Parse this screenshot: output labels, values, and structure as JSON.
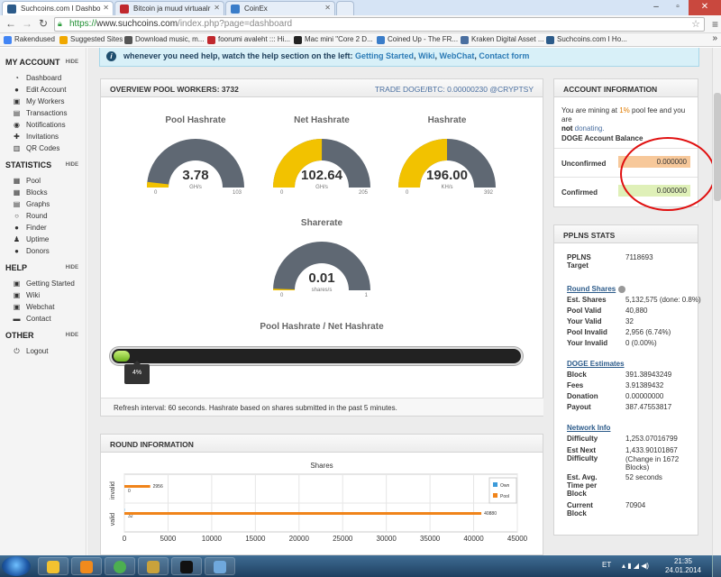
{
  "browser": {
    "tabs": [
      {
        "label": "Suchcoins.com I Dashbo",
        "active": true,
        "color": "#2c5b8a"
      },
      {
        "label": "Bitcoin ja muud virtuaalr",
        "active": false,
        "color": "#c0282d"
      },
      {
        "label": "CoinEx",
        "active": false,
        "color": "#3a7dc9"
      }
    ],
    "url_scheme": "https://",
    "url_host": "www.suchcoins.com",
    "url_path": "/index.php?page=dashboard",
    "bookmarks": [
      {
        "label": "Rakendused",
        "color": "#4285f4"
      },
      {
        "label": "Suggested Sites",
        "color": "#f0a800"
      },
      {
        "label": "Download music, m...",
        "color": "#555555"
      },
      {
        "label": "foorumi avaleht ::: Hi...",
        "color": "#c0282d"
      },
      {
        "label": "Mac mini \"Core 2 D...",
        "color": "#222222"
      },
      {
        "label": "Coined Up - The FR...",
        "color": "#3a7dc9"
      },
      {
        "label": "Kraken Digital Asset ...",
        "color": "#4a6fa0"
      },
      {
        "label": "Suchcoins.com I Ho...",
        "color": "#2c5b8a"
      }
    ],
    "bookmarks_more": "»"
  },
  "sidebar": {
    "sections": [
      {
        "title": "MY ACCOUNT",
        "hide": "HIDE",
        "items": [
          {
            "label": "Dashboard",
            "icon": "dashboard-icon",
            "glyph": "◔"
          },
          {
            "label": "Edit Account",
            "icon": "user-icon",
            "glyph": "●"
          },
          {
            "label": "My Workers",
            "icon": "workers-icon",
            "glyph": "▣"
          },
          {
            "label": "Transactions",
            "icon": "transactions-icon",
            "glyph": "▤"
          },
          {
            "label": "Notifications",
            "icon": "notifications-icon",
            "glyph": "◉"
          },
          {
            "label": "Invitations",
            "icon": "invitations-icon",
            "glyph": "✚"
          },
          {
            "label": "QR Codes",
            "icon": "qr-code-icon",
            "glyph": "▥"
          }
        ]
      },
      {
        "title": "STATISTICS",
        "hide": "HIDE",
        "items": [
          {
            "label": "Pool",
            "icon": "pool-icon",
            "glyph": "▦"
          },
          {
            "label": "Blocks",
            "icon": "blocks-icon",
            "glyph": "▦"
          },
          {
            "label": "Graphs",
            "icon": "graphs-icon",
            "glyph": "▤"
          },
          {
            "label": "Round",
            "icon": "round-icon",
            "glyph": "○"
          },
          {
            "label": "Finder",
            "icon": "finder-icon",
            "glyph": "●"
          },
          {
            "label": "Uptime",
            "icon": "uptime-icon",
            "glyph": "♟"
          },
          {
            "label": "Donors",
            "icon": "donors-icon",
            "glyph": "●"
          }
        ]
      },
      {
        "title": "HELP",
        "hide": "HIDE",
        "items": [
          {
            "label": "Getting Started",
            "icon": "getting-started-icon",
            "glyph": "▣"
          },
          {
            "label": "Wiki",
            "icon": "wiki-icon",
            "glyph": "▣"
          },
          {
            "label": "Webchat",
            "icon": "webchat-icon",
            "glyph": "▣"
          },
          {
            "label": "Contact",
            "icon": "contact-icon",
            "glyph": "▬"
          }
        ]
      },
      {
        "title": "OTHER",
        "hide": "HIDE",
        "items": [
          {
            "label": "Logout",
            "icon": "logout-icon",
            "glyph": "⏻"
          }
        ]
      }
    ]
  },
  "notice": {
    "text": "whenever you need help, watch the help section on the left: ",
    "links": [
      "Getting Started",
      "Wiki",
      "WebChat",
      "Contact form"
    ],
    "sep": ", "
  },
  "overview": {
    "title": "OVERVIEW POOL WORKERS: 3732",
    "trade": "TRADE DOGE/BTC: 0.00000230 @CRYPTSY",
    "gauges": [
      {
        "title": "Pool Hashrate",
        "value": "3.78",
        "unit": "GH/s",
        "min": "0",
        "max": "103",
        "fraction": 0.0367
      },
      {
        "title": "Net Hashrate",
        "value": "102.64",
        "unit": "GH/s",
        "min": "0",
        "max": "205",
        "fraction": 0.5007
      },
      {
        "title": "Hashrate",
        "value": "196.00",
        "unit": "KH/s",
        "min": "0",
        "max": "392",
        "fraction": 0.5
      },
      {
        "title": "Sharerate",
        "value": "0.01",
        "unit": "shares/s",
        "min": "0",
        "max": "1",
        "fraction": 0.01
      }
    ],
    "bar_title": "Pool Hashrate / Net Hashrate",
    "bar_label": "4%",
    "bar_fraction": 0.04,
    "refresh": "Refresh interval: 60 seconds. Hashrate based on shares submitted in the past 5 minutes."
  },
  "account": {
    "title": "ACCOUNT INFORMATION",
    "line1_a": "You are mining at ",
    "line1_fee": "1%",
    "line1_b": " pool fee and you are",
    "line2_not": "not",
    "line2_b": " donating.",
    "balance_title": "DOGE Account Balance",
    "unconfirmed_label": "Unconfirmed",
    "unconfirmed_value": "0.000000",
    "confirmed_label": "Confirmed",
    "confirmed_value": "0.000000",
    "unconfirmed_color": "#f7c89a",
    "confirmed_color": "#dff0b8"
  },
  "pplns": {
    "title": "PPLNS STATS",
    "target_label": "PPLNS Target",
    "target_value": "7118693",
    "round_shares_title": "Round Shares",
    "round_shares": [
      {
        "k": "Est. Shares",
        "v": "5,132,575 (done: 0.8%)"
      },
      {
        "k": "Pool Valid",
        "v": "40,880"
      },
      {
        "k": "Your Valid",
        "v": "32"
      },
      {
        "k": "Pool Invalid",
        "v": "2,956 (6.74%)"
      },
      {
        "k": "Your Invalid",
        "v": "0 (0.00%)"
      }
    ],
    "estimates_title": "DOGE Estimates",
    "estimates": [
      {
        "k": "Block",
        "v": "391.38943249"
      },
      {
        "k": "Fees",
        "v": "3.91389432"
      },
      {
        "k": "Donation",
        "v": "0.00000000"
      },
      {
        "k": "Payout",
        "v": "387.47553817"
      }
    ],
    "network_title": "Network Info",
    "difficulty_label": "Difficulty",
    "difficulty_value": "1,253.07016799",
    "est_next_label": "Est Next Difficulty",
    "est_next_value": "1,433.90101867",
    "est_next_note": "(Change in 1672",
    "est_next_note2": "Blocks)",
    "avg_time_label": "Est. Avg. Time per Block",
    "avg_time_value": "52 seconds",
    "current_block_label": "Current Block",
    "current_block_value": "70904"
  },
  "round": {
    "title": "ROUND INFORMATION"
  },
  "chart_data": {
    "type": "bar",
    "orientation": "horizontal",
    "title": "Shares",
    "categories": [
      "invalid",
      "valid"
    ],
    "series": [
      {
        "name": "Own",
        "values": [
          0,
          32
        ],
        "color": "#3b9ad9"
      },
      {
        "name": "Pool",
        "values": [
          2956,
          40880
        ],
        "color": "#f0841a"
      }
    ],
    "data_labels": {
      "invalid": [
        "0",
        "2956"
      ],
      "valid": [
        "32",
        "40880"
      ]
    },
    "xlim": [
      0,
      45000
    ],
    "xticks": [
      "0",
      "5000",
      "10000",
      "15000",
      "20000",
      "25000",
      "30000",
      "35000",
      "40000",
      "45000"
    ],
    "grid": true,
    "legend": "top-right"
  },
  "taskbar": {
    "apps": [
      {
        "name": "explorer-icon",
        "color": "#f2c230"
      },
      {
        "name": "media-player-icon",
        "color": "#f08a1c"
      },
      {
        "name": "chrome-icon",
        "color": "#4caf50"
      },
      {
        "name": "dogecoin-icon",
        "color": "#c9a23b"
      },
      {
        "name": "cmd-icon",
        "color": "#111111"
      },
      {
        "name": "paint-icon",
        "color": "#6fa8dc"
      }
    ],
    "lang": "ET",
    "time": "21:35",
    "date": "24.01.2014"
  }
}
